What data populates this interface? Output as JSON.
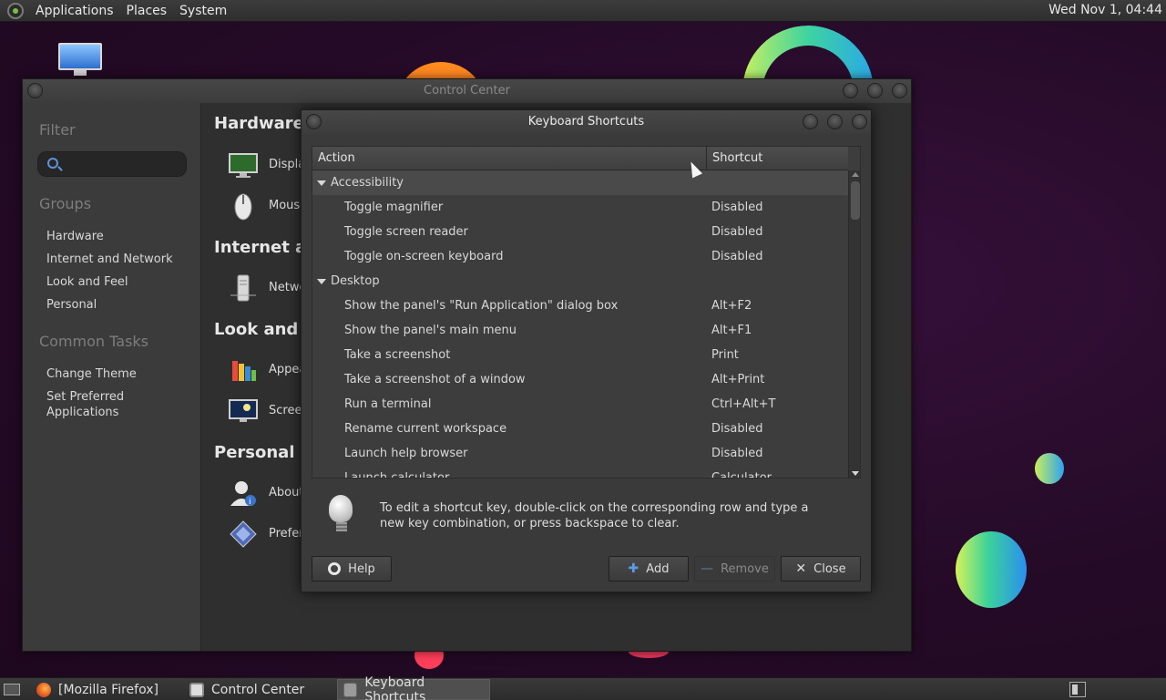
{
  "top_panel": {
    "menus": [
      "Applications",
      "Places",
      "System"
    ],
    "clock": "Wed Nov 1, 04:44"
  },
  "control_center": {
    "title": "Control Center",
    "sidebar": {
      "filter_label": "Filter",
      "search_placeholder": "",
      "groups_label": "Groups",
      "groups": [
        "Hardware",
        "Internet and Network",
        "Look and Feel",
        "Personal"
      ],
      "common_tasks_label": "Common Tasks",
      "tasks": [
        "Change Theme",
        "Set Preferred Applications"
      ]
    },
    "sections": [
      {
        "title": "Hardware",
        "items": [
          "Displa",
          "Mouse"
        ]
      },
      {
        "title": "Internet an",
        "items": [
          "Netwo"
        ]
      },
      {
        "title": "Look and Fe",
        "items": [
          "Appea",
          "Screen"
        ]
      },
      {
        "title": "Personal",
        "items": [
          "About",
          "Prefer"
        ]
      }
    ]
  },
  "keyboard_shortcuts": {
    "title": "Keyboard Shortcuts",
    "columns": {
      "action": "Action",
      "shortcut": "Shortcut"
    },
    "categories": [
      {
        "name": "Accessibility",
        "items": [
          {
            "action": "Toggle magnifier",
            "shortcut": "Disabled"
          },
          {
            "action": "Toggle screen reader",
            "shortcut": "Disabled"
          },
          {
            "action": "Toggle on-screen keyboard",
            "shortcut": "Disabled"
          }
        ]
      },
      {
        "name": "Desktop",
        "items": [
          {
            "action": "Show the panel's \"Run Application\" dialog box",
            "shortcut": "Alt+F2"
          },
          {
            "action": "Show the panel's main menu",
            "shortcut": "Alt+F1"
          },
          {
            "action": "Take a screenshot",
            "shortcut": "Print"
          },
          {
            "action": "Take a screenshot of a window",
            "shortcut": "Alt+Print"
          },
          {
            "action": "Run a terminal",
            "shortcut": "Ctrl+Alt+T"
          },
          {
            "action": "Rename current workspace",
            "shortcut": "Disabled"
          },
          {
            "action": "Launch help browser",
            "shortcut": "Disabled"
          },
          {
            "action": "Launch calculator",
            "shortcut": "Calculator"
          }
        ]
      }
    ],
    "hint": "To edit a shortcut key, double-click on the corresponding row and type a new key combination, or press backspace to clear.",
    "buttons": {
      "help": "Help",
      "add": "Add",
      "remove": "Remove",
      "close": "Close"
    }
  },
  "taskbar": {
    "tasks": [
      {
        "label": "[Mozilla Firefox]",
        "active": false
      },
      {
        "label": "Control Center",
        "active": false
      },
      {
        "label": "Keyboard Shortcuts",
        "active": true
      }
    ]
  }
}
